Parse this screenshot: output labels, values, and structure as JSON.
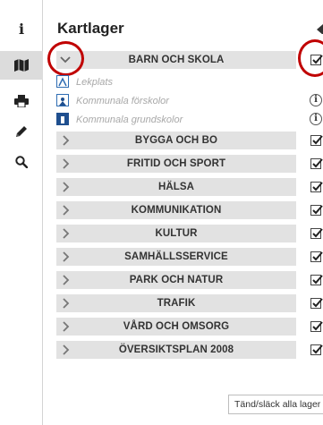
{
  "toolbar": {
    "items": [
      {
        "name": "info-icon",
        "glyph": "i"
      },
      {
        "name": "map-icon"
      },
      {
        "name": "print-icon"
      },
      {
        "name": "pencil-icon"
      },
      {
        "name": "search-icon"
      }
    ],
    "active": "map-icon"
  },
  "panel": {
    "title": "Kartlager"
  },
  "groups": {
    "barn": "BARN OCH SKOLA",
    "bygga": "BYGGA OCH BO",
    "fritid": "FRITID OCH SPORT",
    "halsa": "HÄLSA",
    "kommunikation": "KOMMUNIKATION",
    "kultur": "KULTUR",
    "samhall": "SAMHÄLLSSERVICE",
    "park": "PARK OCH NATUR",
    "trafik": "TRAFIK",
    "vard": "VÅRD OCH OMSORG",
    "oversikt": "ÖVERSIKTSPLAN 2008"
  },
  "layers": {
    "lekplats": "Lekplats",
    "forskolor": "Kommunala förskolor",
    "grundskolor": "Kommunala grundskolor",
    "info_glyph": "i"
  },
  "footer": {
    "toggle_all": "Tänd/släck alla lager"
  },
  "colors": {
    "group_bar": "#e2e2e2",
    "annotation": "#c00000",
    "layer_icon": "#2f6db3"
  }
}
